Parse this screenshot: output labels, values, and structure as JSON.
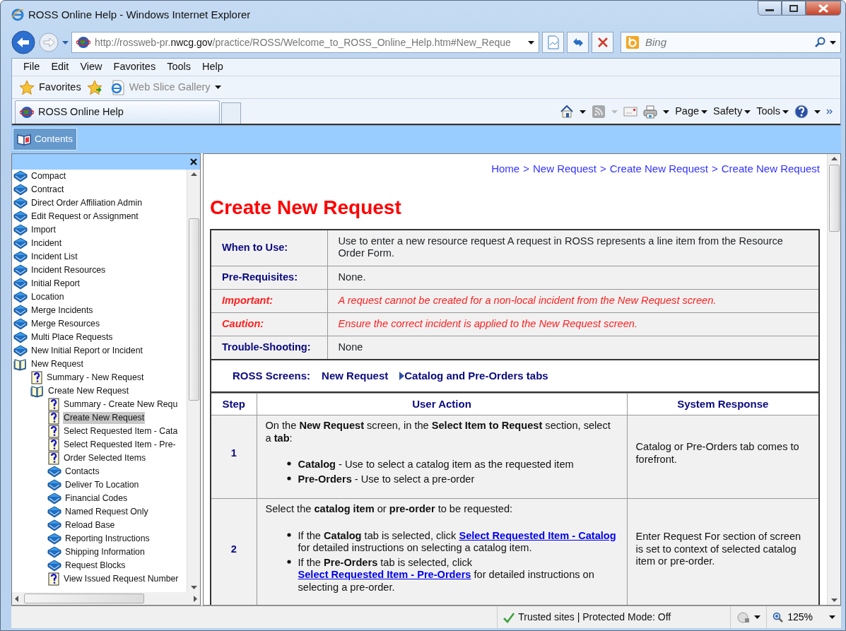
{
  "window": {
    "title": "ROSS Online Help - Windows Internet Explorer"
  },
  "address_bar": {
    "url": "http://rossweb-pr.**nwcg.gov**/practice/ROSS/Welcome_to_ROSS_Online_Help.htm#New_Reque"
  },
  "search": {
    "placeholder": "Bing"
  },
  "menu": [
    "File",
    "Edit",
    "View",
    "Favorites",
    "Tools",
    "Help"
  ],
  "favorites_bar": {
    "favorites": "Favorites",
    "items": [
      {
        "label": "Web Slice Gallery"
      }
    ]
  },
  "tabs": [
    {
      "label": "ROSS Online Help",
      "selected": true
    }
  ],
  "command_bar": [
    {
      "kind": "home",
      "dropdown": true,
      "disabled": false
    },
    {
      "kind": "feeds",
      "dropdown": true,
      "disabled": true
    },
    {
      "kind": "mail",
      "dropdown": false,
      "disabled": false
    },
    {
      "kind": "print",
      "dropdown": true,
      "disabled": false
    },
    {
      "kind": "menu",
      "label": "Page",
      "dropdown": true,
      "disabled": false
    },
    {
      "kind": "menu",
      "label": "Safety",
      "dropdown": true,
      "disabled": false
    },
    {
      "kind": "menu",
      "label": "Tools",
      "dropdown": true,
      "disabled": false
    },
    {
      "kind": "help",
      "dropdown": true,
      "disabled": false
    }
  ],
  "help_toolbar": {
    "contents": {
      "label": "Contents",
      "selected": true
    }
  },
  "toc": [
    {
      "label": "Compact",
      "kind": "book",
      "expanded": false,
      "selected": false
    },
    {
      "label": "Contract",
      "kind": "book",
      "expanded": false,
      "selected": false
    },
    {
      "label": "Direct Order Affiliation Admin",
      "kind": "book",
      "expanded": false,
      "selected": false
    },
    {
      "label": "Edit Request or Assignment",
      "kind": "book",
      "expanded": false,
      "selected": false
    },
    {
      "label": "Import",
      "kind": "book",
      "expanded": false,
      "selected": false
    },
    {
      "label": "Incident",
      "kind": "book",
      "expanded": false,
      "selected": false
    },
    {
      "label": "Incident List",
      "kind": "book",
      "expanded": false,
      "selected": false
    },
    {
      "label": "Incident Resources",
      "kind": "book",
      "expanded": false,
      "selected": false
    },
    {
      "label": "Initial Report",
      "kind": "book",
      "expanded": false,
      "selected": false
    },
    {
      "label": "Location",
      "kind": "book",
      "expanded": false,
      "selected": false
    },
    {
      "label": "Merge Incidents",
      "kind": "book",
      "expanded": false,
      "selected": false
    },
    {
      "label": "Merge Resources",
      "kind": "book",
      "expanded": false,
      "selected": false
    },
    {
      "label": "Multi Place Requests",
      "kind": "book",
      "expanded": false,
      "selected": false
    },
    {
      "label": "New Initial Report or Incident",
      "kind": "book",
      "expanded": false,
      "selected": false
    },
    {
      "label": "New Request",
      "kind": "book",
      "expanded": true,
      "selected": false,
      "children": [
        {
          "label": "Summary - New Request",
          "kind": "page",
          "selected": false
        },
        {
          "label": "Create New Request",
          "kind": "book",
          "expanded": true,
          "selected": false,
          "children": [
            {
              "label": "Summary - Create New Requ",
              "kind": "page",
              "selected": false
            },
            {
              "label": "Create New Request",
              "kind": "page",
              "selected": true
            },
            {
              "label": "Select Requested Item - Cata",
              "kind": "page",
              "selected": false
            },
            {
              "label": "Select Requested Item - Pre-",
              "kind": "page",
              "selected": false
            },
            {
              "label": "Order Selected Items",
              "kind": "page",
              "selected": false
            },
            {
              "label": "Contacts",
              "kind": "book",
              "expanded": false,
              "selected": false
            },
            {
              "label": "Deliver To Location",
              "kind": "book",
              "expanded": false,
              "selected": false
            },
            {
              "label": "Financial Codes",
              "kind": "book",
              "expanded": false,
              "selected": false
            },
            {
              "label": "Named Request Only",
              "kind": "book",
              "expanded": false,
              "selected": false
            },
            {
              "label": "Reload Base",
              "kind": "book",
              "expanded": false,
              "selected": false
            },
            {
              "label": "Reporting Instructions",
              "kind": "book",
              "expanded": false,
              "selected": false
            },
            {
              "label": "Shipping Information",
              "kind": "book",
              "expanded": false,
              "selected": false
            },
            {
              "label": "Request Blocks",
              "kind": "book",
              "expanded": false,
              "selected": false
            },
            {
              "label": "View Issued Request Number",
              "kind": "page",
              "selected": false
            }
          ]
        }
      ]
    }
  ],
  "content": {
    "breadcrumb": [
      "Home",
      "New Request",
      "Create New Request",
      "Create New Request"
    ],
    "breadcrumb_separator": ">",
    "title": "Create New Request",
    "info_rows": [
      {
        "label": "When to Use:",
        "text": "Use to enter a new resource request  A request in ROSS represents a line item from the Resource Order Form.",
        "kind": "normal"
      },
      {
        "label": "Pre-Requisites:",
        "text": "None.",
        "kind": "normal"
      },
      {
        "label": "Important:",
        "text": "A request cannot be created for a non-local incident from the New Request screen.",
        "kind": "warning"
      },
      {
        "label": "Caution:",
        "text": "Ensure the correct incident is applied to the New Request screen.",
        "kind": "warning"
      },
      {
        "label": "Trouble-Shooting:",
        "text": "None",
        "kind": "normal"
      }
    ],
    "screens": {
      "label": "ROSS Screens:",
      "links": [
        {
          "label": "New Request",
          "marker": false
        },
        {
          "label": "Catalog and Pre-Orders tabs",
          "marker": true
        }
      ]
    },
    "steps": {
      "columns": [
        "Step",
        "User Action",
        "System Response"
      ],
      "rows": [
        {
          "step": "1",
          "intro": "On the **New Request** screen, in the **Select Item to Request** section, select a **tab**:",
          "bullets": [
            {
              "text": "**Catalog** - Use to select a catalog item as the requested item"
            },
            {
              "text": "**Pre-Orders** - Use to select a pre-order"
            }
          ],
          "response": "Catalog or Pre-Orders tab comes to forefront."
        },
        {
          "step": "2",
          "intro": "Select the **catalog item** or **pre-order** to be requested:",
          "bullets": [
            {
              "text": "If the **Catalog** tab is selected, click",
              "link": "Select Requested Item - Catalog",
              "after": "for detailed instructions on selecting a catalog item."
            },
            {
              "text": "If the **Pre-Orders** tab is selected, click",
              "link": "Select Requested Item - Pre-Orders",
              "after": "for detailed instructions on selecting a pre-order."
            }
          ],
          "response": "Enter Request For section of screen is set to context of selected catalog item or pre-order."
        }
      ]
    }
  },
  "status_bar": {
    "security": "Trusted sites | Protected Mode: Off",
    "zoom": "125%"
  }
}
